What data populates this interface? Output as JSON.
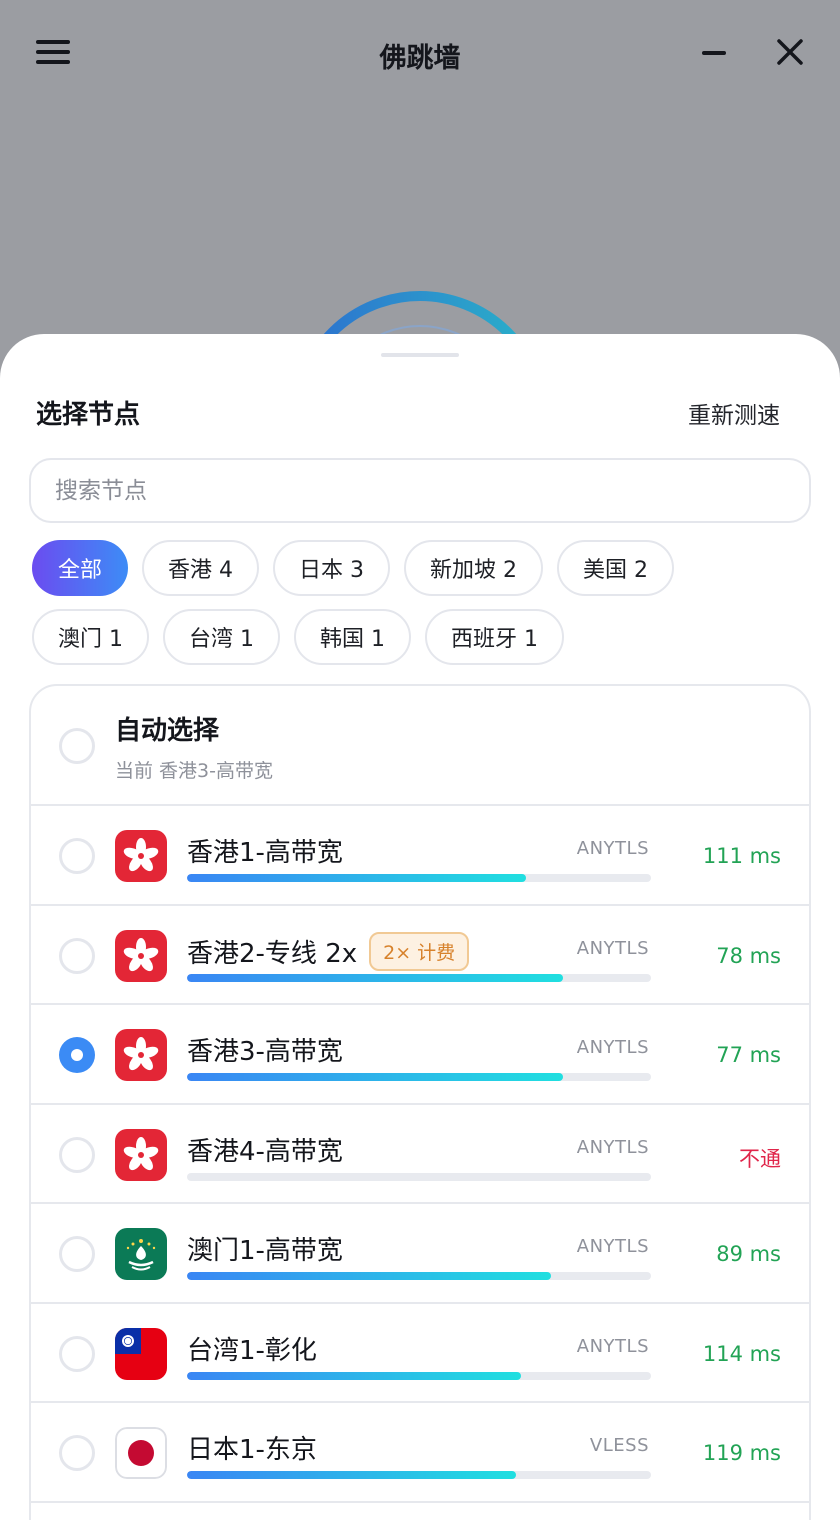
{
  "header": {
    "title": "佛跳墙",
    "menu_icon": "hamburger-menu-icon",
    "minimize_icon": "minimize-icon",
    "close_icon": "close-icon"
  },
  "sheet": {
    "title": "选择节点",
    "retest_label": "重新测速",
    "search_placeholder": "搜索节点"
  },
  "filters": [
    {
      "label": "全部",
      "active": true
    },
    {
      "label": "香港 4",
      "active": false
    },
    {
      "label": "日本 3",
      "active": false
    },
    {
      "label": "新加坡 2",
      "active": false
    },
    {
      "label": "美国 2",
      "active": false
    },
    {
      "label": "澳门 1",
      "active": false
    },
    {
      "label": "台湾 1",
      "active": false
    },
    {
      "label": "韩国 1",
      "active": false
    },
    {
      "label": "西班牙 1",
      "active": false
    }
  ],
  "auto": {
    "title": "自动选择",
    "subtitle": "当前 香港3-高带宽",
    "selected": false
  },
  "nodes": [
    {
      "name": "香港1-高带宽",
      "badge": "",
      "flag": "hk",
      "protocol": "ANYTLS",
      "latency": "111 ms",
      "status": "ok",
      "quality": 0.73,
      "selected": false
    },
    {
      "name": "香港2-专线 2x",
      "badge": "2× 计费",
      "flag": "hk",
      "protocol": "ANYTLS",
      "latency": "78 ms",
      "status": "ok",
      "quality": 0.81,
      "selected": false
    },
    {
      "name": "香港3-高带宽",
      "badge": "",
      "flag": "hk",
      "protocol": "ANYTLS",
      "latency": "77 ms",
      "status": "ok",
      "quality": 0.81,
      "selected": true
    },
    {
      "name": "香港4-高带宽",
      "badge": "",
      "flag": "hk",
      "protocol": "ANYTLS",
      "latency": "不通",
      "status": "bad",
      "quality": 0,
      "selected": false
    },
    {
      "name": "澳门1-高带宽",
      "badge": "",
      "flag": "mo",
      "protocol": "ANYTLS",
      "latency": "89 ms",
      "status": "ok",
      "quality": 0.785,
      "selected": false
    },
    {
      "name": "台湾1-彰化",
      "badge": "",
      "flag": "tw",
      "protocol": "ANYTLS",
      "latency": "114 ms",
      "status": "ok",
      "quality": 0.72,
      "selected": false
    },
    {
      "name": "日本1-东京",
      "badge": "",
      "flag": "jp",
      "protocol": "VLESS",
      "latency": "119 ms",
      "status": "ok",
      "quality": 0.71,
      "selected": false
    }
  ],
  "colors": {
    "accent": "#3b8bf5",
    "ok": "#22a355",
    "bad": "#e0254a",
    "badge": "#d7822c"
  }
}
